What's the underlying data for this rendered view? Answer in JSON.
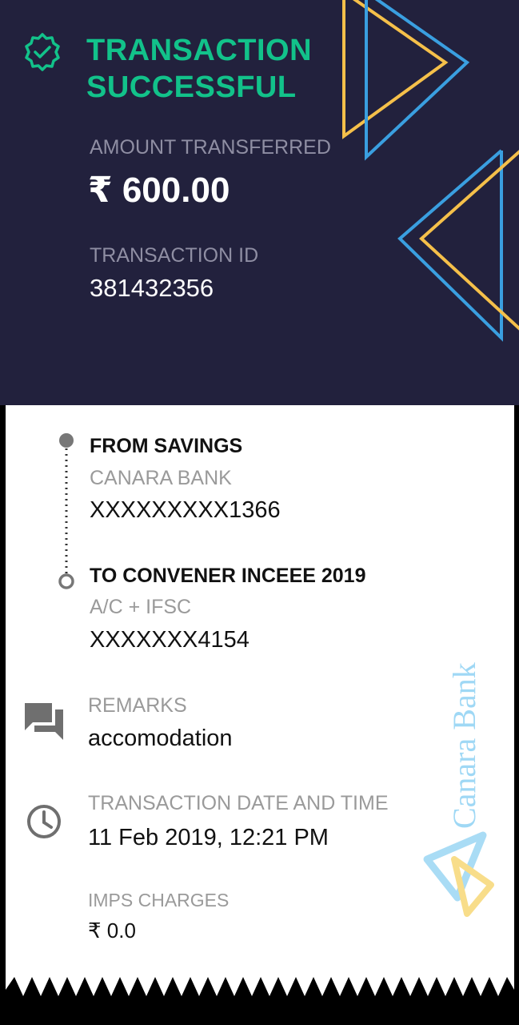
{
  "status": {
    "title_line1": "TRANSACTION",
    "title_line2": "SUCCESSFUL",
    "icon": "check-badge-icon"
  },
  "amount": {
    "label": "AMOUNT TRANSFERRED",
    "value": "₹ 600.00"
  },
  "transaction": {
    "id_label": "TRANSACTION ID",
    "id_value": "381432356"
  },
  "from": {
    "title": "FROM SAVINGS",
    "bank": "CANARA BANK",
    "account": "XXXXXXXXX1366"
  },
  "to": {
    "title": "TO CONVENER INCEEE 2019",
    "type": "A/C + IFSC",
    "account": "XXXXXXX4154"
  },
  "remarks": {
    "label": "REMARKS",
    "value": "accomodation",
    "icon": "chat-bubbles-icon"
  },
  "datetime": {
    "label": "TRANSACTION DATE AND TIME",
    "value": "11 Feb 2019, 12:21 PM",
    "icon": "clock-icon"
  },
  "charges": {
    "label": "IMPS CHARGES",
    "value": "₹ 0.0"
  },
  "watermark": {
    "text": "Canara Bank"
  },
  "colors": {
    "header_bg": "#22213d",
    "success_green": "#12c28a",
    "accent_blue": "#3a9fe0",
    "accent_yellow": "#f5c04a"
  }
}
